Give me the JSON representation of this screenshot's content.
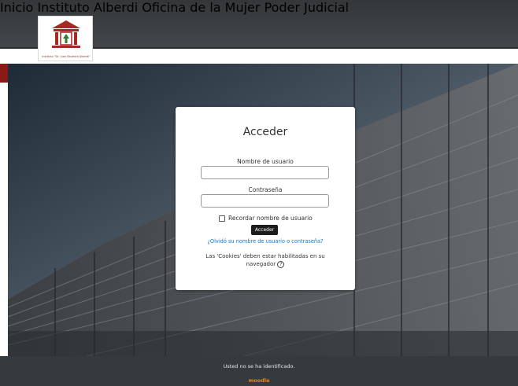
{
  "header": {
    "logo_caption": "Instituto \"Dr. Juan Bautista Alberdi\"",
    "nav": [
      "Inicio",
      "Instituto Alberdi",
      "Oficina de la Mujer",
      "Poder Judicial"
    ]
  },
  "login": {
    "title": "Acceder",
    "username_label": "Nombre de usuario",
    "username_value": "",
    "password_label": "Contraseña",
    "password_value": "",
    "remember_label": "Recordar nombre de usuario",
    "remember_checked": false,
    "submit_label": "Acceder",
    "forgot_link": "¿Olvidó su nombre de usuario o contraseña?",
    "cookies_text": "Las 'Cookies' deben estar habilitadas en su navegador",
    "help_icon": "question-circle-icon"
  },
  "footer": {
    "status": "Usted no se ha identificado.",
    "brand": "moodle"
  },
  "colors": {
    "header_bg": "#3c3f41",
    "accent_red": "#8b1a16",
    "button_bg": "#1d1d1d",
    "link": "#1177d1",
    "moodle_orange": "#f98012"
  }
}
